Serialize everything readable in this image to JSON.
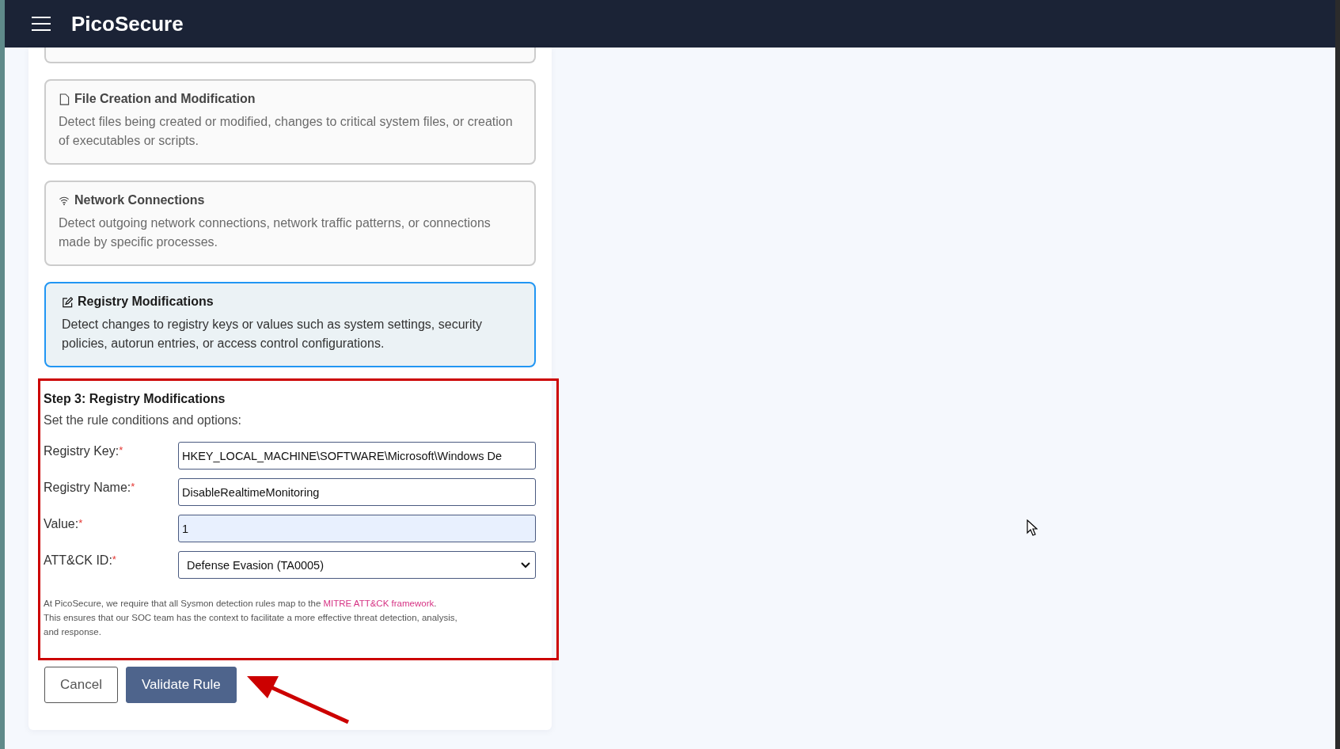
{
  "header": {
    "title": "PicoSecure"
  },
  "cards": [
    {
      "kind": "file",
      "title": "File Creation and Modification",
      "description": "Detect files being created or modified, changes to critical system files, or creation of executables or scripts.",
      "selected": false
    },
    {
      "kind": "wifi",
      "title": "Network Connections",
      "description": "Detect outgoing network connections, network traffic patterns, or connections made by specific processes.",
      "selected": false
    },
    {
      "kind": "edit",
      "title": "Registry Modifications",
      "description": "Detect changes to registry keys or values such as system settings, security policies, autorun entries, or access control configurations.",
      "selected": true
    }
  ],
  "step": {
    "title": "Step 3: Registry Modifications",
    "subtitle": "Set the rule conditions and options:",
    "fields": [
      {
        "kind": "input",
        "label": "Registry Key:",
        "required_mark": "*",
        "value": "HKEY_LOCAL_MACHINE\\SOFTWARE\\Microsoft\\Windows De",
        "highlighted": false
      },
      {
        "kind": "input",
        "label": "Registry Name:",
        "required_mark": "*",
        "value": "DisableRealtimeMonitoring",
        "highlighted": false
      },
      {
        "kind": "input",
        "label": "Value:",
        "required_mark": "*",
        "value": "1",
        "highlighted": true
      },
      {
        "kind": "select",
        "label": "ATT&CK ID:",
        "required_mark": "*",
        "value": "Defense Evasion (TA0005)",
        "highlighted": false
      }
    ],
    "note": {
      "before": "At PicoSecure, we require that all Sysmon detection rules map to the ",
      "link": "MITRE ATT&CK framework",
      "after": ".",
      "second": "This ensures that our SOC team has the context to facilitate a more effective threat detection, analysis, and response."
    }
  },
  "buttons": [
    {
      "kind": "secondary",
      "label": "Cancel"
    },
    {
      "kind": "primary",
      "label": "Validate Rule"
    }
  ]
}
